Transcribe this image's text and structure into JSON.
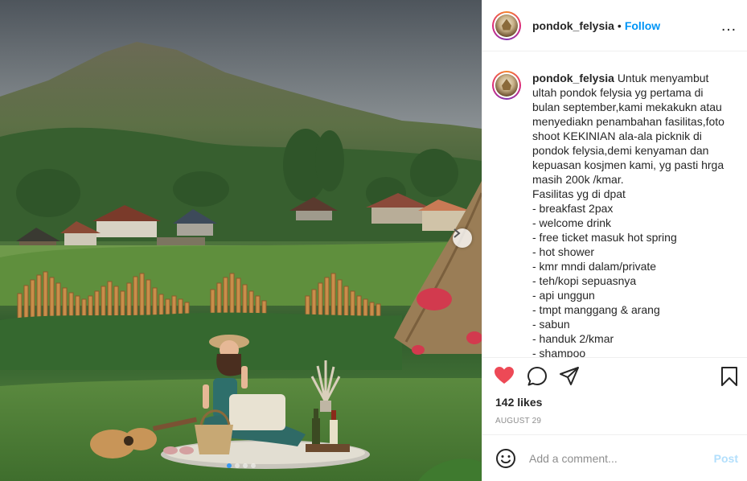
{
  "post": {
    "username": "pondok_felysia",
    "follow_label": "Follow",
    "separator": "•",
    "more_icon": "…",
    "caption_lines": [
      "Untuk menyambut",
      "ultah pondok felysia yg pertama di",
      "bulan september,kami mekakukn atau",
      "menyediakn penambahan fasilitas,foto",
      "shoot KEKINIAN ala-ala picknik di",
      "pondok felysia,demi kenyaman dan",
      "kepuasan kosjmen kami, yg pasti hrga",
      "masih 200k /kmar.",
      "Fasilitas yg di dpat",
      "- breakfast 2pax",
      "- welcome drink",
      "- free ticket masuk hot spring",
      "- hot shower",
      "- kmr mndi dalam/private",
      "- teh/kopi sepuasnya",
      "- api unggun",
      "- tmpt manggang & arang",
      "- sabun",
      "- handuk 2/kmar",
      "- shampoo"
    ],
    "likes": "142 likes",
    "date": "AUGUST 29",
    "comment_placeholder": "Add a comment...",
    "post_label": "Post",
    "like_color": "#ed4956",
    "follow_color": "#0095f6",
    "icons": [
      "heart-icon",
      "comment-icon",
      "share-icon",
      "bookmark-icon",
      "emoji-icon",
      "chevron-right-icon"
    ],
    "carousel": {
      "slides": 4,
      "active_index": 0
    }
  }
}
